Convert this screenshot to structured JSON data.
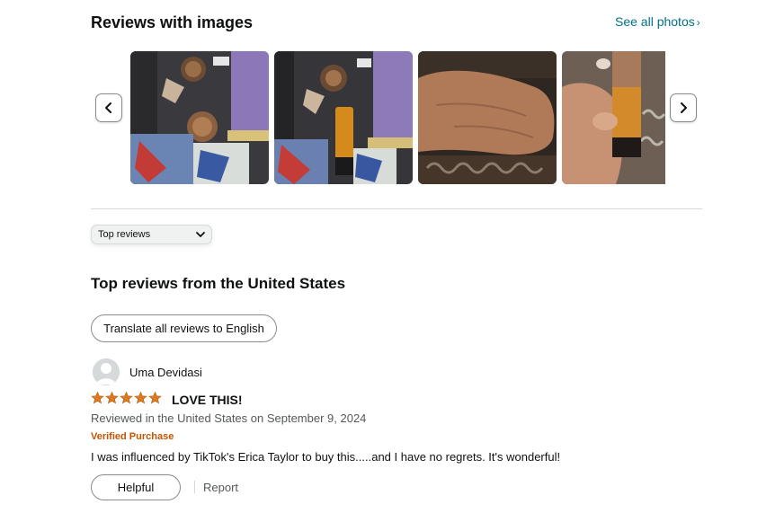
{
  "images_section": {
    "title": "Reviews with images",
    "see_all_label": "See all photos",
    "icons": {
      "prev": "chevron-left-icon",
      "next": "chevron-right-icon"
    }
  },
  "sort": {
    "selected": "Top reviews"
  },
  "reviews_section": {
    "title": "Top reviews from the United States",
    "translate_label": "Translate all reviews to English"
  },
  "review": {
    "reviewer": "Uma Devidasi",
    "rating": 5,
    "max_rating": 5,
    "title": "LOVE THIS!",
    "date_line": "Reviewed in the United States on September 9, 2024",
    "badge": "Verified Purchase",
    "body": "I was influenced by TikTok's Erica Taylor to buy this.....and I have no regrets. It's wonderful!",
    "helpful_label": "Helpful",
    "report_label": "Report"
  },
  "colors": {
    "link": "#007185",
    "star": "#de7921",
    "verified": "#c45500",
    "muted_text": "#565959"
  }
}
